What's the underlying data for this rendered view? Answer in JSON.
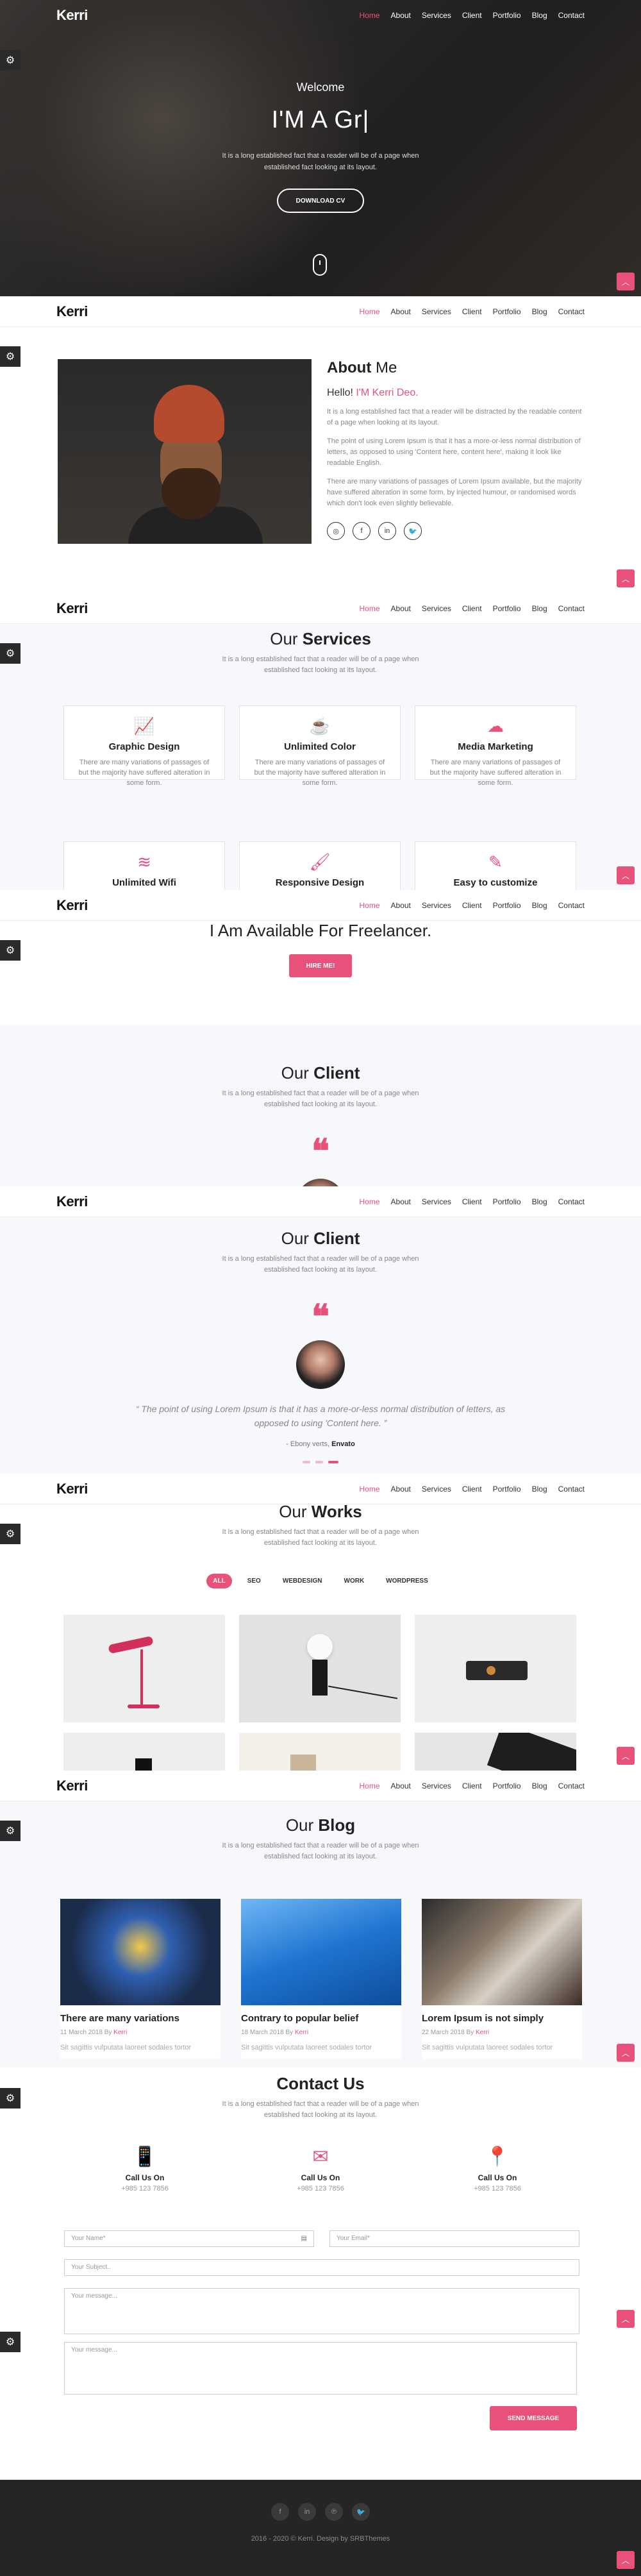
{
  "brand": {
    "logo": "Kerri",
    "accent": "#e8527a"
  },
  "nav": {
    "items": [
      "Home",
      "About",
      "Services",
      "Client",
      "Portfolio",
      "Blog",
      "Contact"
    ]
  },
  "hero": {
    "welcome": "Welcome",
    "headline": "I'M A Gr|",
    "description": "It is a long established fact that a reader will be of a page when established fact looking at its layout.",
    "button": "DOWNLOAD CV"
  },
  "about": {
    "title_light": "About",
    "title_bold": "Me",
    "hello": "Hello!",
    "name": "I'M Kerri Deo.",
    "p1": "It is a long established fact that a reader will be distracted by the readable content of a page when looking at its layout.",
    "p2": "The point of using Lorem Ipsum is that it has a more-or-less normal distribution of letters, as opposed to using 'Content here, content here', making it look like readable English.",
    "p3": "There are many variations of passages of Lorem Ipsum available, but the majority have suffered alteration in some form, by injected humour, or randomised words which don't look even slightly believable.",
    "social": [
      "◎",
      "f",
      "in",
      "🐦"
    ]
  },
  "section_subtitle": "It is a long established fact that a reader will be of a page when established fact looking at its layout.",
  "services": {
    "title_light": "Our",
    "title_bold": "Services",
    "items": [
      {
        "icon": "chart-icon",
        "glyph": "📈",
        "title": "Graphic Design",
        "text": "There are many variations of passages of but the majority have suffered alteration in some form."
      },
      {
        "icon": "coffee-icon",
        "glyph": "☕",
        "title": "Unlimited Color",
        "text": "There are many variations of passages of but the majority have suffered alteration in some form."
      },
      {
        "icon": "cloud-upload-icon",
        "glyph": "☁",
        "title": "Media Marketing",
        "text": "There are many variations of passages of but the majority have suffered alteration in some form."
      },
      {
        "icon": "layers-icon",
        "glyph": "≋",
        "title": "Unlimited Wifi",
        "text": ""
      },
      {
        "icon": "brush-icon",
        "glyph": "🖌",
        "title": "Responsive Design",
        "text": ""
      },
      {
        "icon": "edit-icon",
        "glyph": "✎",
        "title": "Easy to customize",
        "text": ""
      }
    ]
  },
  "hire": {
    "title": "I Am Available For Freelancer.",
    "button": "HIRE ME!"
  },
  "client": {
    "title_light": "Our",
    "title_bold": "Client",
    "quote": "“ The point of using Lorem Ipsum is that it has a more-or-less normal distribution of letters, as opposed to using 'Content here. ”",
    "author_prefix": "- Ebony verts,",
    "author_company": "Envato"
  },
  "works": {
    "title_light": "Our",
    "title_bold": "Works",
    "filters": [
      "ALL",
      "SEO",
      "WEBDESIGN",
      "WORK",
      "WORDPRESS"
    ]
  },
  "blog": {
    "title_light": "Our",
    "title_bold": "Blog",
    "posts": [
      {
        "title": "There are many variations",
        "date": "11 March 2018",
        "by": "By",
        "author": "Kerri",
        "excerpt": "Sit sagittis vulputata laoreet sodales tortor"
      },
      {
        "title": "Contrary to popular belief",
        "date": "18 March 2018",
        "by": "By",
        "author": "Kerri",
        "excerpt": "Sit sagittis vulputata laoreet sodales tortor"
      },
      {
        "title": "Lorem Ipsum is not simply",
        "date": "22 March 2018",
        "by": "By",
        "author": "Kerri",
        "excerpt": "Sit sagittis vulputata laoreet sodales tortor"
      }
    ]
  },
  "contact": {
    "title": "Contact Us",
    "items": [
      {
        "icon": "phone-icon",
        "glyph": "📱",
        "label": "Call Us On",
        "value": "+985 123 7856"
      },
      {
        "icon": "mail-icon",
        "glyph": "✉",
        "label": "Call Us On",
        "value": "+985 123 7856"
      },
      {
        "icon": "location-icon",
        "glyph": "📍",
        "label": "Call Us On",
        "value": "+985 123 7856"
      }
    ],
    "name_placeholder": "Your Name*",
    "email_placeholder": "Your Email*",
    "subject_placeholder": "Your Subject..",
    "message_placeholder": "Your message...",
    "send": "SEND MESSAGE"
  },
  "footer": {
    "social": [
      "f",
      "in",
      "℗",
      "🐦"
    ],
    "copyright": "2016 - 2020 © Kerri. Design by SRBThemes"
  }
}
